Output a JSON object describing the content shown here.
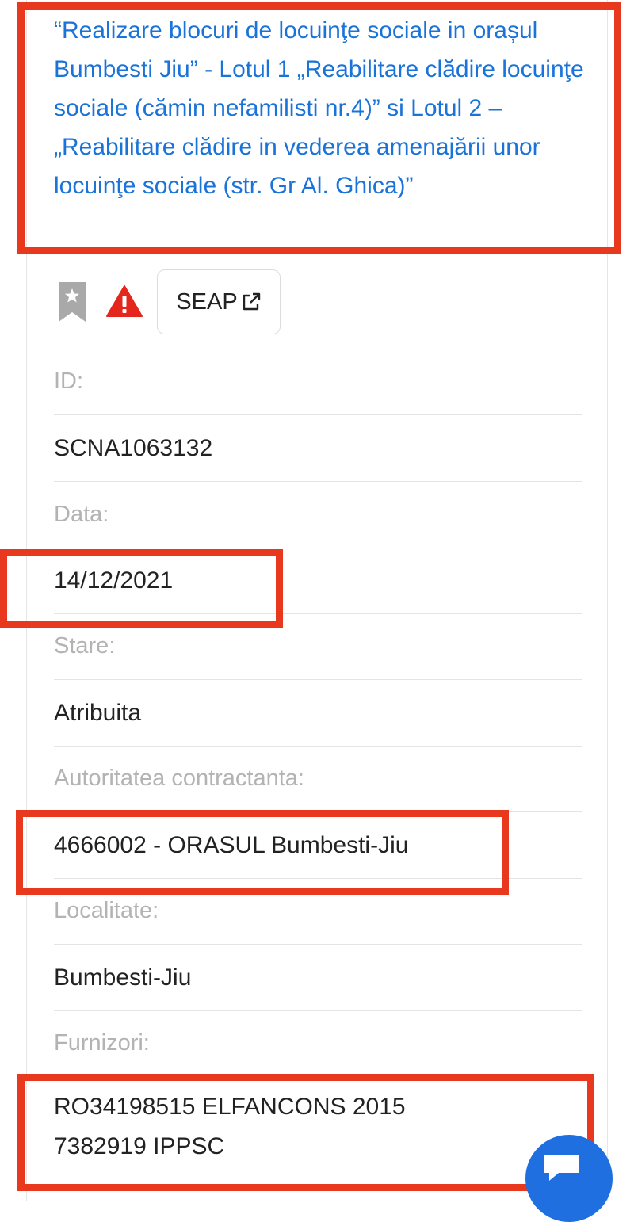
{
  "tender": {
    "title": "“Realizare blocuri de locuinţe sociale in orașul Bumbesti Jiu” - Lotul 1 „Reabilitare clădire locuinţe sociale (cămin nefamilisti nr.4)” si Lotul 2 –„Reabilitare clădire in vederea amenajării unor locuinţe sociale (str. Gr Al. Ghica)”"
  },
  "actions": {
    "bookmark_icon": "bookmark-star-icon",
    "warning_icon": "warning-triangle-icon",
    "seap_label": "SEAP",
    "seap_icon": "external-link-icon"
  },
  "fields": {
    "id_label": "ID:",
    "id_value": "SCNA1063132",
    "data_label": "Data:",
    "data_value": "14/12/2021",
    "stare_label": "Stare:",
    "stare_value": "Atribuita",
    "autoritate_label": "Autoritatea contractanta:",
    "autoritate_value": "4666002 - ORASUL Bumbesti-Jiu",
    "localitate_label": "Localitate:",
    "localitate_value": "Bumbesti-Jiu",
    "furnizori_label": "Furnizori:",
    "furnizori_line1": "RO34198515 ELFANCONS 2015",
    "furnizori_line2": "7382919 IPPSC"
  },
  "colors": {
    "link_blue": "#1a73d9",
    "highlight_red": "#e8391e",
    "warning_red": "#e4261c",
    "chat_blue": "#1f6fe0"
  }
}
